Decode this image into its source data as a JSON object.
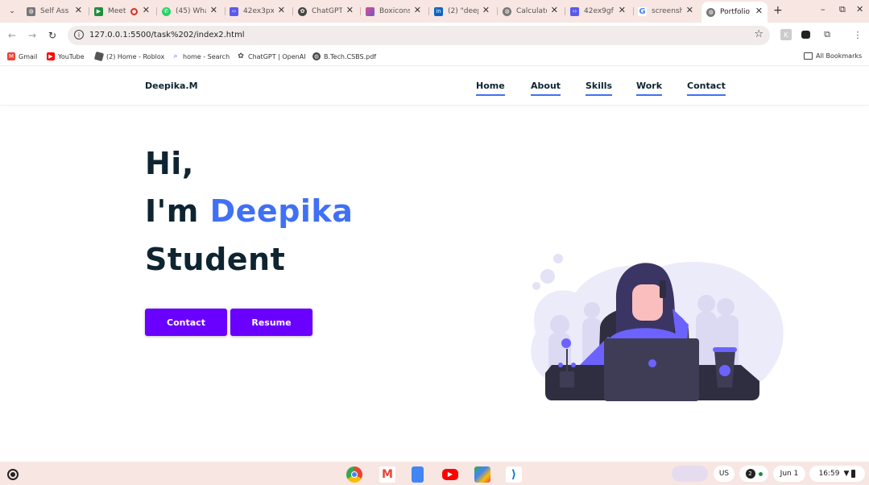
{
  "tabs": [
    {
      "label": "Self Ass",
      "favicon": "globe-icon",
      "color": "#777"
    },
    {
      "label": "Meet",
      "favicon": "meet-icon",
      "color": "#1e8e3e"
    },
    {
      "label": "(45) Wha",
      "favicon": "whatsapp-icon",
      "color": "#25d366"
    },
    {
      "label": "42ex3px",
      "favicon": "code-icon",
      "color": "#5a5aed"
    },
    {
      "label": "ChatGPT",
      "favicon": "chatgpt-icon",
      "color": "#444"
    },
    {
      "label": "Boxicons",
      "favicon": "boxicons-icon",
      "color": "#e04b8f"
    },
    {
      "label": "(2) \"deep",
      "favicon": "linkedin-icon",
      "color": "#0a66c2"
    },
    {
      "label": "Calculato",
      "favicon": "globe-icon",
      "color": "#777"
    },
    {
      "label": "42ex9gf",
      "favicon": "code-icon",
      "color": "#5a5aed"
    },
    {
      "label": "screensh",
      "favicon": "google-icon",
      "color": "#4285f4"
    },
    {
      "label": "Portfolio",
      "favicon": "globe-icon",
      "color": "#777",
      "active": true
    }
  ],
  "address_bar": {
    "url": "127.0.0.1:5500/task%202/index2.html"
  },
  "bookmarks": [
    {
      "label": "Gmail",
      "color": "#ea4335"
    },
    {
      "label": "YouTube",
      "color": "#ff0000"
    },
    {
      "label": "(2) Home - Roblox",
      "color": "#555"
    },
    {
      "label": "home - Search",
      "color": "#4a6ee0"
    },
    {
      "label": "ChatGPT | OpenAI",
      "color": "#444"
    },
    {
      "label": "B.Tech.CSBS.pdf",
      "color": "#444"
    }
  ],
  "all_bookmarks": "All Bookmarks",
  "site": {
    "logo": "Deepika.M",
    "nav": [
      "Home",
      "About",
      "Skills",
      "Work",
      "Contact"
    ],
    "hero": {
      "line1": "Hi,",
      "line2_prefix": "I'm ",
      "name": "Deepika",
      "line3": "Student"
    },
    "buttons": {
      "contact": "Contact",
      "resume": "Resume"
    },
    "accent": "#4070f4",
    "button_color": "#6a00ff"
  },
  "shelf": {
    "apps": [
      "chrome-icon",
      "gmail-icon",
      "docs-icon",
      "youtube-icon",
      "play-store-icon",
      "vscode-icon"
    ],
    "locale": "US",
    "notification_count": "2",
    "date": "Jun 1",
    "time": "16:59"
  }
}
